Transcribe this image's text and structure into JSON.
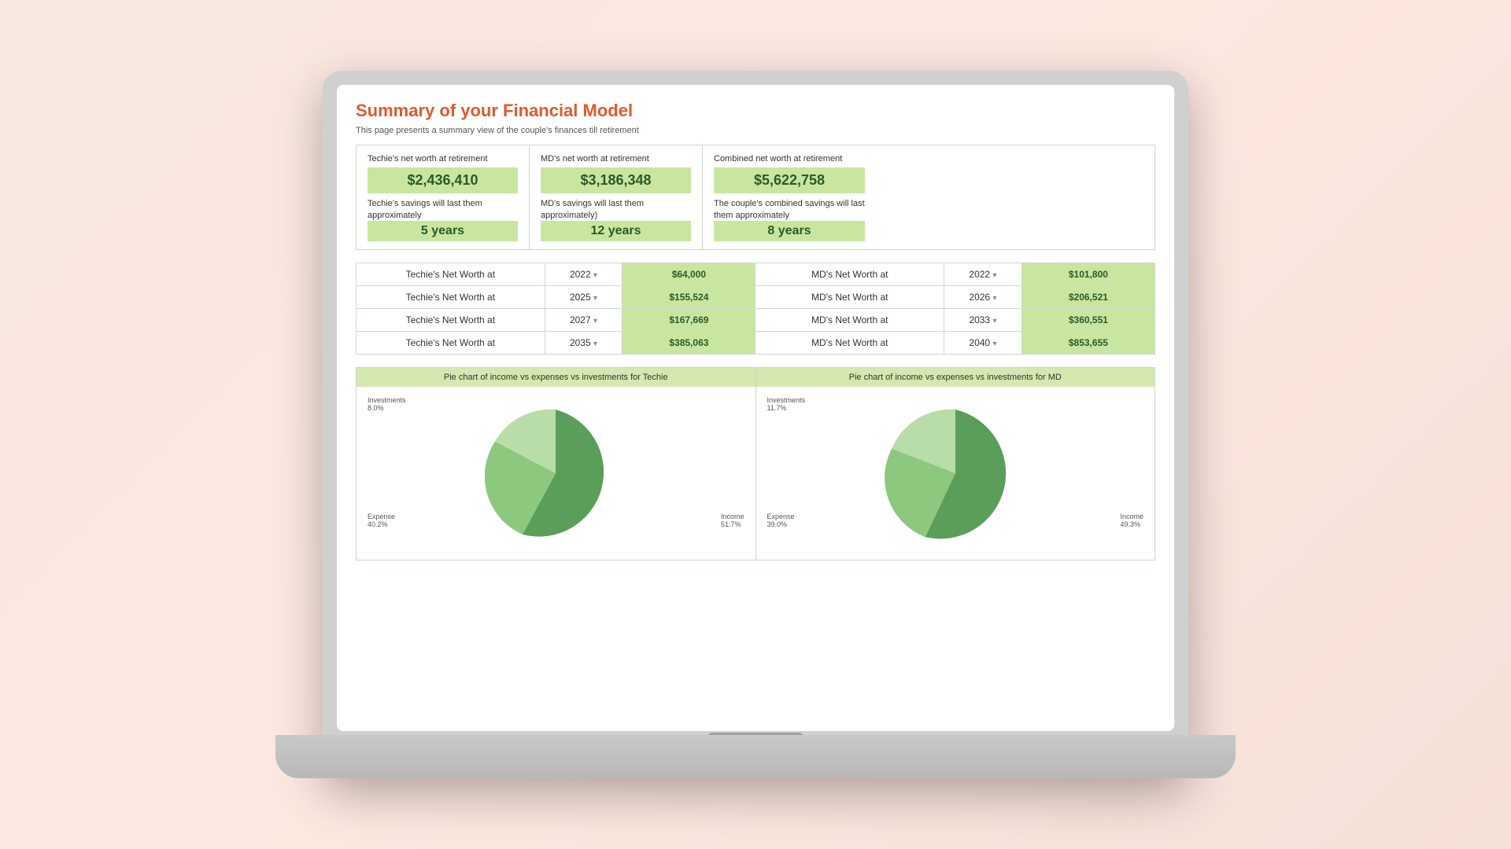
{
  "page": {
    "title": "Summary of your Financial Model",
    "subtitle": "This page presents a summary view of the couple's finances till retirement"
  },
  "summary": {
    "techie": {
      "label1": "Techie's net worth at retirement",
      "value1": "$2,436,410",
      "label2": "Techie's savings will last them approximately",
      "value2": "5 years"
    },
    "md": {
      "label1": "MD's net worth at retirement",
      "value1": "$3,186,348",
      "label2": "MD's savings will last them approximately)",
      "value2": "12 years"
    },
    "combined": {
      "label1": "Combined net worth at retirement",
      "value1": "$5,622,758",
      "label2": "The couple's combined savings will last them approximately",
      "value2": "8 years"
    }
  },
  "techie_rows": [
    {
      "label": "Techie's Net Worth at",
      "year": "2022",
      "value": "$64,000"
    },
    {
      "label": "Techie's Net Worth at",
      "year": "2025",
      "value": "$155,524"
    },
    {
      "label": "Techie's Net Worth at",
      "year": "2027",
      "value": "$167,669"
    },
    {
      "label": "Techie's Net Worth at",
      "year": "2035",
      "value": "$385,063"
    }
  ],
  "md_rows": [
    {
      "label": "MD's Net Worth at",
      "year": "2022",
      "value": "$101,800"
    },
    {
      "label": "MD's Net Worth at",
      "year": "2026",
      "value": "$206,521"
    },
    {
      "label": "MD's Net Worth at",
      "year": "2033",
      "value": "$360,551"
    },
    {
      "label": "MD's Net Worth at",
      "year": "2040",
      "value": "$853,655"
    }
  ],
  "charts": {
    "techie": {
      "header": "Pie chart of income vs expenses vs investments for Techie",
      "segments": [
        {
          "label": "Income",
          "percent": "51.7%",
          "color": "#5a9e5a",
          "startAngle": 0,
          "endAngle": 186
        },
        {
          "label": "Expense",
          "percent": "40.2%",
          "color": "#8cc87e",
          "startAngle": 186,
          "endAngle": 331
        },
        {
          "label": "Investments",
          "percent": "8.0%",
          "color": "#b8dda8",
          "startAngle": 331,
          "endAngle": 360
        }
      ]
    },
    "md": {
      "header": "Pie chart of income vs expenses vs investments for MD",
      "segments": [
        {
          "label": "Income",
          "percent": "49.3%",
          "color": "#5a9e5a",
          "startAngle": 0,
          "endAngle": 178
        },
        {
          "label": "Expense",
          "percent": "39.0%",
          "color": "#8cc87e",
          "startAngle": 178,
          "endAngle": 318
        },
        {
          "label": "Investments",
          "percent": "11.7%",
          "color": "#b8dda8",
          "startAngle": 318,
          "endAngle": 360
        }
      ]
    }
  }
}
